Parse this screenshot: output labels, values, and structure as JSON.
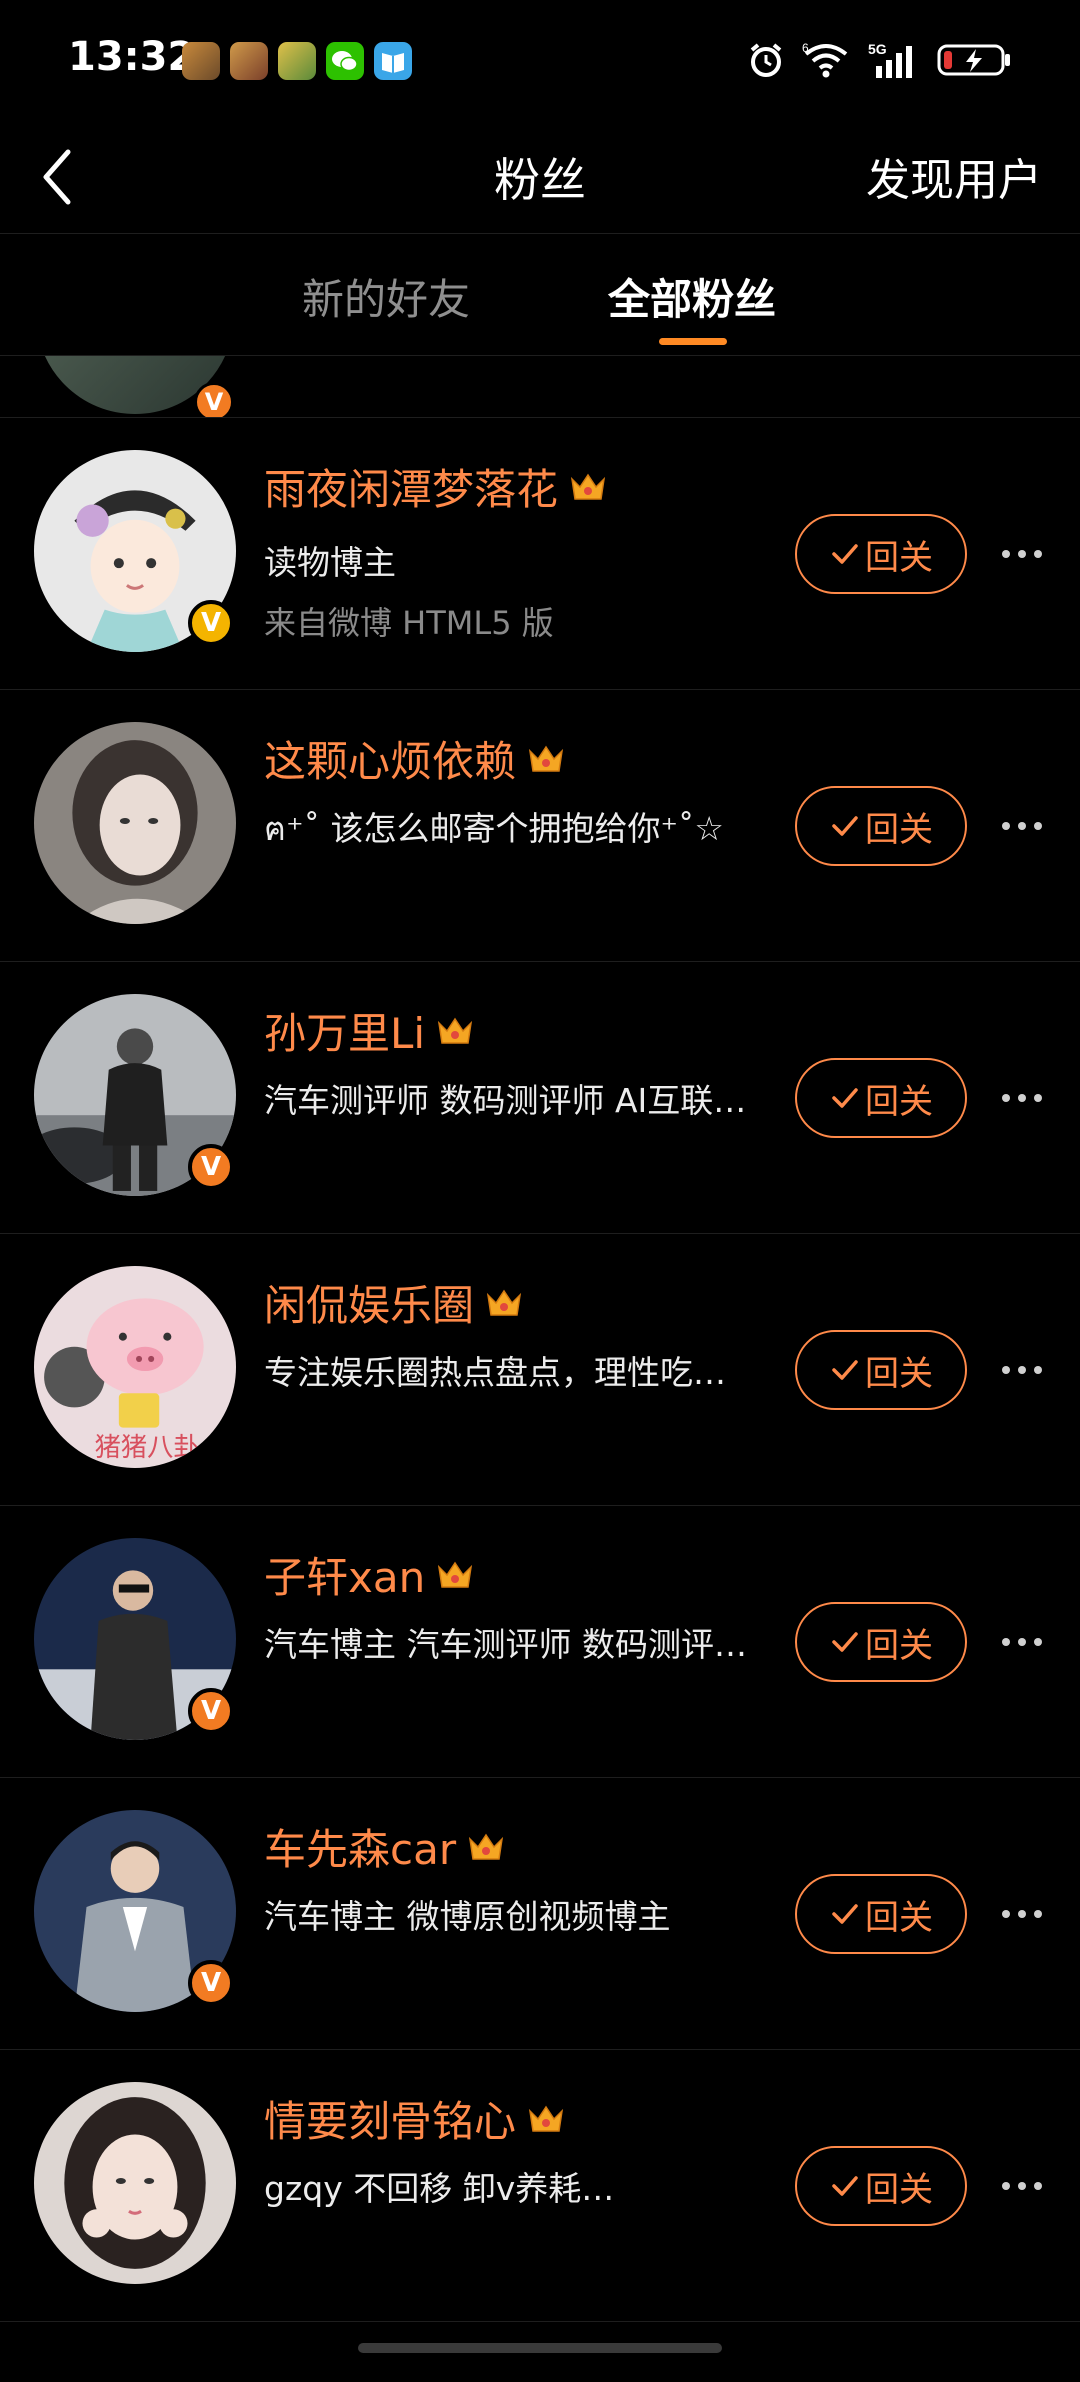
{
  "status_bar": {
    "time": "13:32",
    "notification_icons": [
      "game-icon",
      "game-icon",
      "game-icon",
      "wechat-icon",
      "reader-icon"
    ],
    "system_icons": [
      "alarm-icon",
      "wifi-icon",
      "signal-5g-icon",
      "battery-charging-icon"
    ],
    "network_label": "5G",
    "wifi_label": "6"
  },
  "header": {
    "title": "粉丝",
    "discover_label": "发现用户"
  },
  "tabs": [
    {
      "label": "新的好友",
      "active": false
    },
    {
      "label": "全部粉丝",
      "active": true
    }
  ],
  "colors": {
    "accent": "#ff8a4a",
    "tab_indicator": "#ff8a24",
    "verified_orange": "#f27b22",
    "verified_gold": "#f4b400",
    "background": "#000000"
  },
  "followers": [
    {
      "name": "雨夜闲潭梦落花",
      "desc": "读物博主",
      "source": "来自微博 HTML5 版",
      "badge": "V",
      "badge_color": "gold",
      "button": "回关"
    },
    {
      "name": "这颗心烦依赖",
      "desc": "ฅ⁺˚ 该怎么邮寄个拥抱给你⁺˚☆",
      "source": "",
      "badge": "",
      "badge_color": "",
      "button": "回关"
    },
    {
      "name": "孙万里Li",
      "desc": "汽车测评师 数码测评师 AI互联…",
      "source": "",
      "badge": "V",
      "badge_color": "orange",
      "button": "回关"
    },
    {
      "name": "闲侃娱乐圈",
      "desc": "专注娱乐圈热点盘点，理性吃…",
      "source": "",
      "badge": "",
      "badge_color": "",
      "button": "回关"
    },
    {
      "name": "子轩xan",
      "desc": "汽车博主 汽车测评师 数码测评…",
      "source": "",
      "badge": "V",
      "badge_color": "orange",
      "button": "回关"
    },
    {
      "name": "车先森car",
      "desc": "汽车博主 微博原创视频博主",
      "source": "",
      "badge": "V",
      "badge_color": "orange",
      "button": "回关"
    },
    {
      "name": "情要刻骨铭心",
      "desc": "gzqy 不回移 卸v养耗…",
      "source": "",
      "badge": "",
      "badge_color": "",
      "button": "回关"
    }
  ],
  "partial_row_badge": "V"
}
